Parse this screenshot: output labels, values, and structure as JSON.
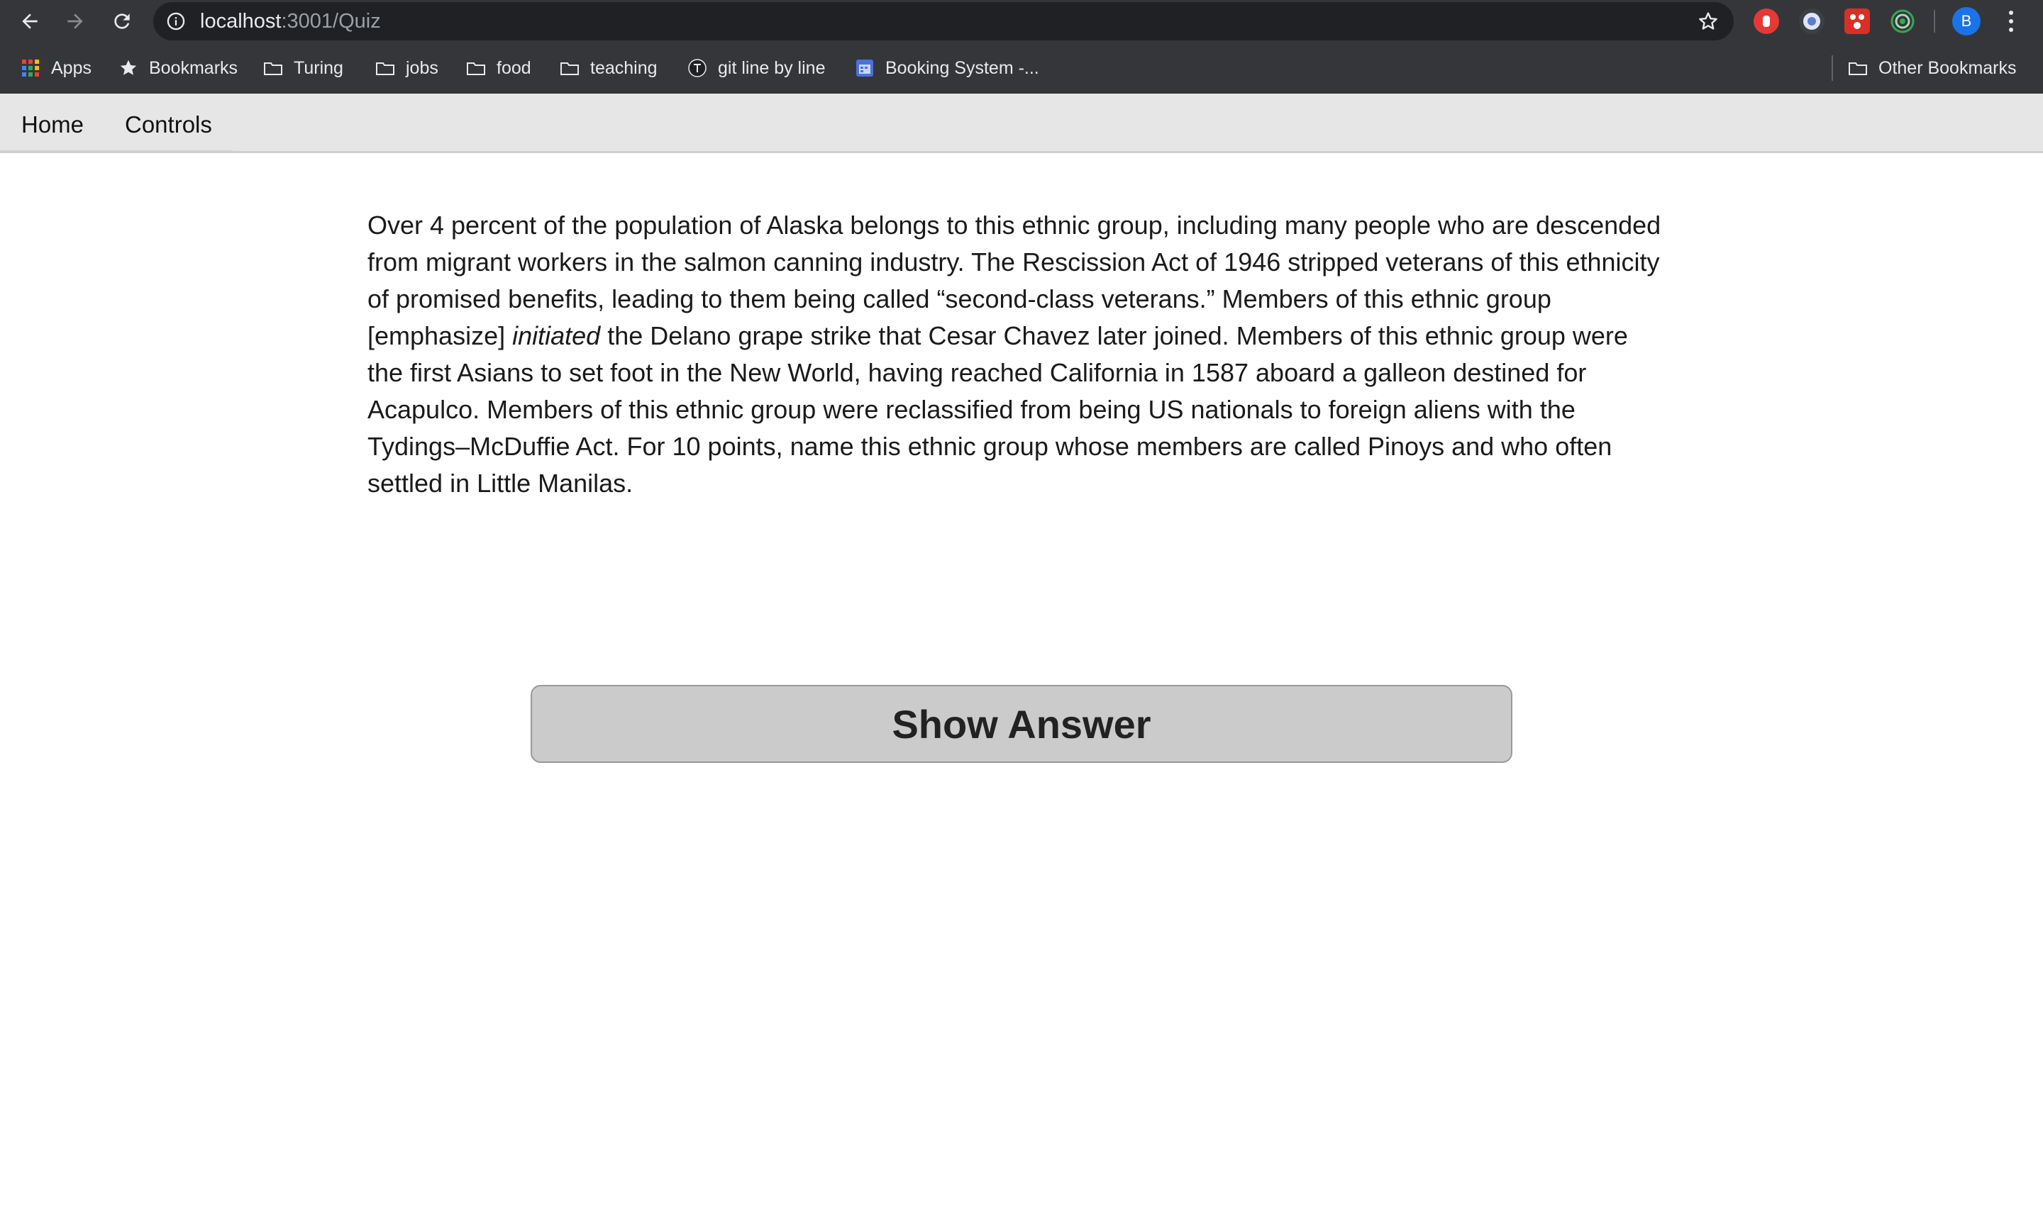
{
  "browser": {
    "url_host": "localhost",
    "url_path": ":3001/Quiz",
    "avatar_letter": "B",
    "back_icon": "arrow-left-icon",
    "forward_icon": "arrow-right-icon",
    "reload_icon": "reload-icon",
    "extensions": [
      {
        "name": "ad-block-extension",
        "color": "#e53935"
      },
      {
        "name": "blue-ring-extension",
        "color": "#8ab4f8"
      },
      {
        "name": "red-grid-extension",
        "color": "#d93025"
      },
      {
        "name": "green-target-extension",
        "color": "#34a853"
      }
    ]
  },
  "bookmarks": {
    "items": [
      {
        "label": "Apps",
        "icon": "apps-grid-icon"
      },
      {
        "label": "Bookmarks",
        "icon": "star-icon"
      },
      {
        "label": "Turing",
        "icon": "folder-icon"
      },
      {
        "label": "jobs",
        "icon": "folder-icon"
      },
      {
        "label": "food",
        "icon": "folder-icon"
      },
      {
        "label": "teaching",
        "icon": "folder-icon"
      },
      {
        "label": "git line by line",
        "icon": "site-favicon-icon"
      },
      {
        "label": "Booking System -...",
        "icon": "calendar-favicon-icon"
      }
    ],
    "other": "Other Bookmarks"
  },
  "app": {
    "nav": {
      "home": "Home",
      "controls": "Controls"
    },
    "question": {
      "before_emphasis": "Over 4 percent of the population of Alaska belongs to this ethnic group, including many people who are descended from migrant workers in the salmon canning industry. The Rescission Act of 1946 stripped veterans of this ethnicity of promised benefits, leading to them being called “second-class veterans.” Members of this ethnic group [emphasize] ",
      "emphasis": "initiated",
      "after_emphasis": " the Delano grape strike that Cesar Chavez later joined. Members of this ethnic group were the first Asians to set foot in the New World, having reached California in 1587 aboard a galleon destined for Acapulco. Members of this ethnic group were reclassified from being US nationals to foreign aliens with the Tydings–McDuffie Act. For 10 points, name this ethnic group whose members are called Pinoys and who often settled in Little Manilas."
    },
    "show_answer": "Show Answer"
  }
}
